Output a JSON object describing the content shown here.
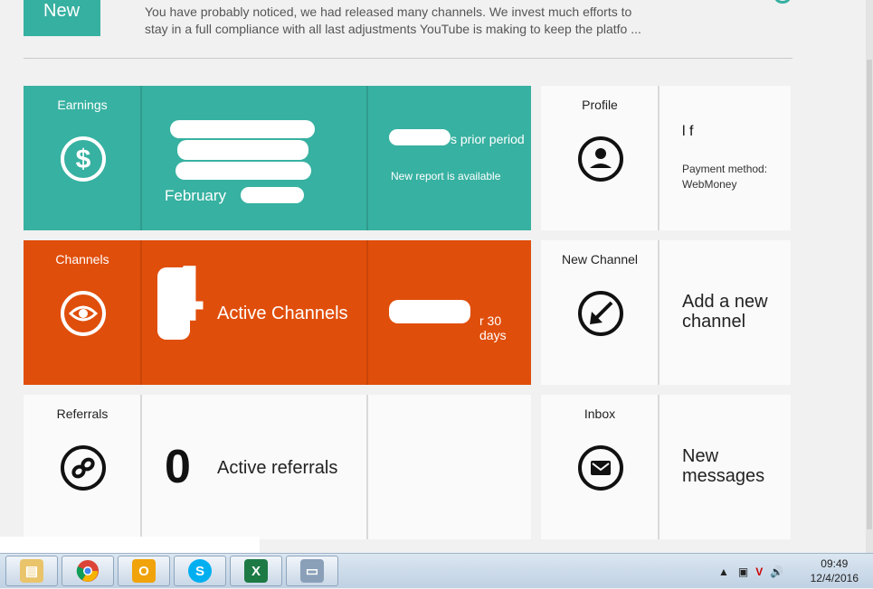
{
  "news": {
    "badge": "New",
    "line1": "You have probably noticed, we had released many channels. We invest much efforts to",
    "line2": "stay in a full compliance with all last adjustments YouTube is making to keep the platfo ..."
  },
  "earnings": {
    "label": "Earnings",
    "period_text": "February",
    "prior_text": "s prior period",
    "report_text": "New report is available"
  },
  "channels": {
    "label": "Channels",
    "count": "4",
    "active_text": "Active Channels",
    "days_text": "r 30 days"
  },
  "referrals": {
    "label": "Referrals",
    "count": "0",
    "active_text": "Active referrals"
  },
  "profile": {
    "label": "Profile",
    "name_fragment": "l      f",
    "payment_label": "Payment method:",
    "payment_value": "WebMoney"
  },
  "new_channel": {
    "label": "New Channel",
    "action_line1": "Add a new",
    "action_line2": "channel"
  },
  "inbox": {
    "label": "Inbox",
    "line1": "New",
    "line2": "messages"
  },
  "taskbar": {
    "apps": [
      "explorer-icon",
      "chrome-icon",
      "outlook-icon",
      "skype-icon",
      "excel-icon",
      "remote-desktop-icon"
    ],
    "time": "09:49",
    "date": "12/4/2016"
  },
  "colors": {
    "teal": "#37b1a1",
    "orange": "#e04e0b",
    "tile_white": "#fafafa"
  }
}
